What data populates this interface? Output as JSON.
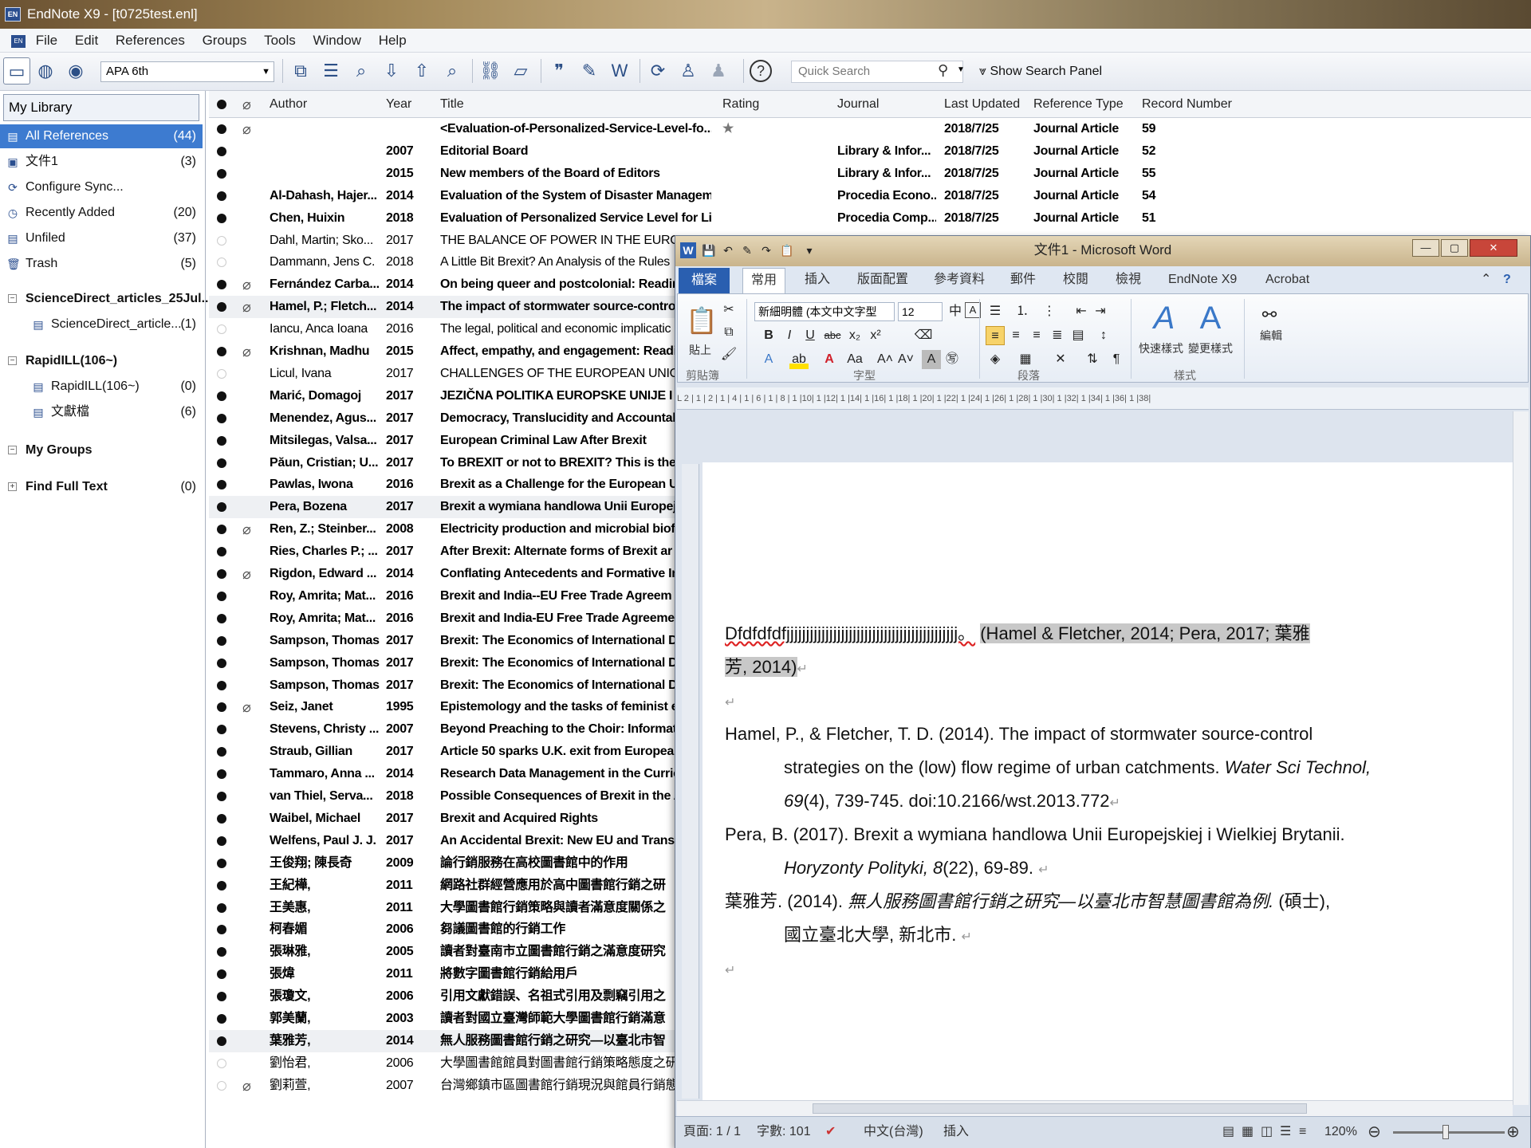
{
  "app": {
    "title": "EndNote X9 - [t0725test.enl]",
    "icon_label": "EN"
  },
  "menu": [
    "File",
    "Edit",
    "References",
    "Groups",
    "Tools",
    "Window",
    "Help"
  ],
  "toolbar": {
    "style": "APA 6th",
    "search_placeholder": "Quick Search",
    "show_search": "Show Search Panel"
  },
  "sidebar": {
    "my_library": "My Library",
    "items": [
      {
        "label": "All References",
        "count": "(44)",
        "icon": "references-icon"
      },
      {
        "label": "文件1",
        "count": "(3)",
        "icon": "word-doc-icon"
      },
      {
        "label": "Configure Sync...",
        "count": "",
        "icon": "sync-icon"
      },
      {
        "label": "Recently Added",
        "count": "(20)",
        "icon": "clock-icon"
      },
      {
        "label": "Unfiled",
        "count": "(37)",
        "icon": "references-icon"
      },
      {
        "label": "Trash",
        "count": "(5)",
        "icon": "trash-icon"
      }
    ],
    "groups": [
      {
        "label": "ScienceDirect_articles_25Jul...",
        "children": [
          {
            "label": "ScienceDirect_article...",
            "count": "(1)"
          }
        ]
      },
      {
        "label": "RapidILL(106~)",
        "children": [
          {
            "label": "RapidILL(106~)",
            "count": "(0)"
          },
          {
            "label": "文獻檔",
            "count": "(6)"
          }
        ]
      },
      {
        "label": "My Groups",
        "children": []
      },
      {
        "label": "Find Full Text",
        "count": "(0)",
        "children": []
      }
    ]
  },
  "columns": [
    "Author",
    "Year",
    "Title",
    "Rating",
    "Journal",
    "Last Updated",
    "Reference Type",
    "Record Number"
  ],
  "rows": [
    {
      "author": "",
      "year": "",
      "title": "<Evaluation-of-Personalized-Service-Level-fo...",
      "rating": "★",
      "journal": "",
      "updated": "2018/7/25",
      "type": "Journal Article",
      "record": "59",
      "clip": true,
      "bold": true,
      "read": true
    },
    {
      "author": "",
      "year": "2007",
      "title": "Editorial Board",
      "rating": "",
      "journal": "Library & Infor...",
      "updated": "2018/7/25",
      "type": "Journal Article",
      "record": "52",
      "clip": false,
      "bold": true,
      "read": true
    },
    {
      "author": "",
      "year": "2015",
      "title": "New members of the Board of Editors",
      "rating": "",
      "journal": "Library & Infor...",
      "updated": "2018/7/25",
      "type": "Journal Article",
      "record": "55",
      "clip": false,
      "bold": true,
      "read": true
    },
    {
      "author": "Al-Dahash, Hajer...",
      "year": "2014",
      "title": "Evaluation of the System of Disaster Managem...",
      "rating": "",
      "journal": "Procedia Econo...",
      "updated": "2018/7/25",
      "type": "Journal Article",
      "record": "54",
      "clip": false,
      "bold": true,
      "read": true
    },
    {
      "author": "Chen, Huixin",
      "year": "2018",
      "title": "Evaluation of Personalized Service Level for Li...",
      "rating": "",
      "journal": "Procedia Comp...",
      "updated": "2018/7/25",
      "type": "Journal Article",
      "record": "51",
      "clip": false,
      "bold": true,
      "read": true
    },
    {
      "author": "Dahl, Martin; Sko...",
      "year": "2017",
      "title": "THE BALANCE OF POWER IN THE EUROPEA",
      "rating": "",
      "journal": "",
      "updated": "",
      "type": "",
      "record": "",
      "clip": false,
      "bold": false,
      "read": false
    },
    {
      "author": "Dammann, Jens C.",
      "year": "2018",
      "title": "A Little Bit Brexit? An Analysis of the Rules",
      "rating": "",
      "journal": "",
      "updated": "",
      "type": "",
      "record": "",
      "clip": false,
      "bold": false,
      "read": false
    },
    {
      "author": "Fernández Carba...",
      "year": "2014",
      "title": "On being queer and postcolonial: Reading",
      "rating": "",
      "journal": "",
      "updated": "",
      "type": "",
      "record": "",
      "clip": true,
      "bold": true,
      "read": true
    },
    {
      "author": "Hamel, P.; Fletch...",
      "year": "2014",
      "title": "The impact of stormwater source-contro",
      "rating": "",
      "journal": "",
      "updated": "",
      "type": "",
      "record": "",
      "clip": true,
      "bold": true,
      "read": true,
      "alt": true
    },
    {
      "author": "Iancu, Anca Ioana",
      "year": "2016",
      "title": "The legal, political and economic implicatic",
      "rating": "",
      "journal": "",
      "updated": "",
      "type": "",
      "record": "",
      "clip": false,
      "bold": false,
      "read": false
    },
    {
      "author": "Krishnan, Madhu",
      "year": "2015",
      "title": "Affect, empathy, and engagement: Readi",
      "rating": "",
      "journal": "",
      "updated": "",
      "type": "",
      "record": "",
      "clip": true,
      "bold": true,
      "read": true
    },
    {
      "author": "Licul, Ivana",
      "year": "2017",
      "title": "CHALLENGES OF THE EUROPEAN UNION A",
      "rating": "",
      "journal": "",
      "updated": "",
      "type": "",
      "record": "",
      "clip": false,
      "bold": false,
      "read": false
    },
    {
      "author": "Marić, Domagoj",
      "year": "2017",
      "title": "JEZIČNA POLITIKA EUROPSKE UNIJE I BR",
      "rating": "",
      "journal": "",
      "updated": "",
      "type": "",
      "record": "",
      "clip": false,
      "bold": true,
      "read": true
    },
    {
      "author": "Menendez, Agus...",
      "year": "2017",
      "title": "Democracy, Translucidity and Accountabi",
      "rating": "",
      "journal": "",
      "updated": "",
      "type": "",
      "record": "",
      "clip": false,
      "bold": true,
      "read": true
    },
    {
      "author": "Mitsilegas, Valsa...",
      "year": "2017",
      "title": "European Criminal Law After Brexit",
      "rating": "",
      "journal": "",
      "updated": "",
      "type": "",
      "record": "",
      "clip": false,
      "bold": true,
      "read": true
    },
    {
      "author": "Păun, Cristian; U...",
      "year": "2017",
      "title": "To BREXIT or not to BREXIT? This is the (e",
      "rating": "",
      "journal": "",
      "updated": "",
      "type": "",
      "record": "",
      "clip": false,
      "bold": true,
      "read": true
    },
    {
      "author": "Pawlas, Iwona",
      "year": "2016",
      "title": "Brexit as a Challenge for the European Ur",
      "rating": "",
      "journal": "",
      "updated": "",
      "type": "",
      "record": "",
      "clip": false,
      "bold": true,
      "read": true
    },
    {
      "author": "Pera, Bozena",
      "year": "2017",
      "title": "Brexit a wymiana handlowa Unii Europejs",
      "rating": "",
      "journal": "",
      "updated": "",
      "type": "",
      "record": "",
      "clip": false,
      "bold": true,
      "read": true,
      "alt": true
    },
    {
      "author": "Ren, Z.; Steinber...",
      "year": "2008",
      "title": "Electricity production and microbial biofil",
      "rating": "",
      "journal": "",
      "updated": "",
      "type": "",
      "record": "",
      "clip": true,
      "bold": true,
      "read": true
    },
    {
      "author": "Ries, Charles P.; ...",
      "year": "2017",
      "title": "After Brexit: Alternate forms of Brexit ar",
      "rating": "",
      "journal": "",
      "updated": "",
      "type": "",
      "record": "",
      "clip": false,
      "bold": true,
      "read": true
    },
    {
      "author": "Rigdon, Edward ...",
      "year": "2014",
      "title": "Conflating Antecedents and Formative In",
      "rating": "",
      "journal": "",
      "updated": "",
      "type": "",
      "record": "",
      "clip": true,
      "bold": true,
      "read": true
    },
    {
      "author": "Roy, Amrita; Mat...",
      "year": "2016",
      "title": "Brexit and India--EU Free Trade Agreem",
      "rating": "",
      "journal": "",
      "updated": "",
      "type": "",
      "record": "",
      "clip": false,
      "bold": true,
      "read": true
    },
    {
      "author": "Roy, Amrita; Mat...",
      "year": "2016",
      "title": "Brexit and India-EU Free Trade Agreeme",
      "rating": "",
      "journal": "",
      "updated": "",
      "type": "",
      "record": "",
      "clip": false,
      "bold": true,
      "read": true
    },
    {
      "author": "Sampson, Thomas",
      "year": "2017",
      "title": "Brexit: The Economics of International D",
      "rating": "",
      "journal": "",
      "updated": "",
      "type": "",
      "record": "",
      "clip": false,
      "bold": true,
      "read": true
    },
    {
      "author": "Sampson, Thomas",
      "year": "2017",
      "title": "Brexit: The Economics of International D",
      "rating": "",
      "journal": "",
      "updated": "",
      "type": "",
      "record": "",
      "clip": false,
      "bold": true,
      "read": true
    },
    {
      "author": "Sampson, Thomas",
      "year": "2017",
      "title": "Brexit: The Economics of International D",
      "rating": "",
      "journal": "",
      "updated": "",
      "type": "",
      "record": "",
      "clip": false,
      "bold": true,
      "read": true
    },
    {
      "author": "Seiz, Janet",
      "year": "1995",
      "title": "Epistemology and the tasks of feminist ec",
      "rating": "",
      "journal": "",
      "updated": "",
      "type": "",
      "record": "",
      "clip": true,
      "bold": true,
      "read": true
    },
    {
      "author": "Stevens, Christy ...",
      "year": "2007",
      "title": "Beyond Preaching to the Choir: Informati",
      "rating": "",
      "journal": "",
      "updated": "",
      "type": "",
      "record": "",
      "clip": false,
      "bold": true,
      "read": true
    },
    {
      "author": "Straub, Gillian",
      "year": "2017",
      "title": "Article 50 sparks U.K. exit from European",
      "rating": "",
      "journal": "",
      "updated": "",
      "type": "",
      "record": "",
      "clip": false,
      "bold": true,
      "read": true
    },
    {
      "author": "Tammaro, Anna ...",
      "year": "2014",
      "title": "Research Data Management in the Curric",
      "rating": "",
      "journal": "",
      "updated": "",
      "type": "",
      "record": "",
      "clip": false,
      "bold": true,
      "read": true
    },
    {
      "author": "van Thiel, Serva...",
      "year": "2018",
      "title": "Possible Consequences of Brexit in the A",
      "rating": "",
      "journal": "",
      "updated": "",
      "type": "",
      "record": "",
      "clip": false,
      "bold": true,
      "read": true
    },
    {
      "author": "Waibel, Michael",
      "year": "2017",
      "title": "Brexit and Acquired Rights",
      "rating": "",
      "journal": "",
      "updated": "",
      "type": "",
      "record": "",
      "clip": false,
      "bold": true,
      "read": true
    },
    {
      "author": "Welfens, Paul J. J.",
      "year": "2017",
      "title": "An Accidental Brexit: New EU and Transa",
      "rating": "",
      "journal": "",
      "updated": "",
      "type": "",
      "record": "",
      "clip": false,
      "bold": true,
      "read": true
    },
    {
      "author": "王俊翔; 陳長奇",
      "year": "2009",
      "title": "論行銷服務在高校圖書館中的作用",
      "rating": "",
      "journal": "",
      "updated": "",
      "type": "",
      "record": "",
      "clip": false,
      "bold": true,
      "read": true
    },
    {
      "author": "王紀樺,",
      "year": "2011",
      "title": "網路社群經營應用於高中圖書館行銷之研",
      "rating": "",
      "journal": "",
      "updated": "",
      "type": "",
      "record": "",
      "clip": false,
      "bold": true,
      "read": true
    },
    {
      "author": "王美惠,",
      "year": "2011",
      "title": "大學圖書館行銷策略與讀者滿意度關係之",
      "rating": "",
      "journal": "",
      "updated": "",
      "type": "",
      "record": "",
      "clip": false,
      "bold": true,
      "read": true
    },
    {
      "author": "柯春媚",
      "year": "2006",
      "title": "芻議圖書館的行銷工作",
      "rating": "",
      "journal": "",
      "updated": "",
      "type": "",
      "record": "",
      "clip": false,
      "bold": true,
      "read": true
    },
    {
      "author": "張琳雅,",
      "year": "2005",
      "title": "讀者對臺南市立圖書館行銷之滿意度研究",
      "rating": "",
      "journal": "",
      "updated": "",
      "type": "",
      "record": "",
      "clip": false,
      "bold": true,
      "read": true
    },
    {
      "author": "張煒",
      "year": "2011",
      "title": "將數字圖書館行銷給用戶",
      "rating": "",
      "journal": "",
      "updated": "",
      "type": "",
      "record": "",
      "clip": false,
      "bold": true,
      "read": true
    },
    {
      "author": "張瓊文,",
      "year": "2006",
      "title": "引用文獻錯誤、名祖式引用及剽竊引用之",
      "rating": "",
      "journal": "",
      "updated": "",
      "type": "",
      "record": "",
      "clip": false,
      "bold": true,
      "read": true
    },
    {
      "author": "郭美蘭,",
      "year": "2003",
      "title": "讀者對國立臺灣師範大學圖書館行銷滿意",
      "rating": "",
      "journal": "",
      "updated": "",
      "type": "",
      "record": "",
      "clip": false,
      "bold": true,
      "read": true
    },
    {
      "author": "葉雅芳,",
      "year": "2014",
      "title": "無人服務圖書館行銷之研究—以臺北市智",
      "rating": "",
      "journal": "",
      "updated": "",
      "type": "",
      "record": "",
      "clip": false,
      "bold": true,
      "read": true,
      "alt": true
    },
    {
      "author": "劉怡君,",
      "year": "2006",
      "title": "大學圖書館館員對圖書館行銷策略態度之研",
      "rating": "",
      "journal": "",
      "updated": "",
      "type": "",
      "record": "",
      "clip": false,
      "bold": false,
      "read": false
    },
    {
      "author": "劉莉萱,",
      "year": "2007",
      "title": "台灣鄉鎮市區圖書館行銷現況與館員行銷態",
      "rating": "",
      "journal": "",
      "updated": "",
      "type": "",
      "record": "",
      "clip": true,
      "bold": false,
      "read": false
    }
  ],
  "word": {
    "title": "文件1 - Microsoft Word",
    "tabs": [
      "檔案",
      "常用",
      "插入",
      "版面配置",
      "參考資料",
      "郵件",
      "校閱",
      "檢視",
      "EndNote X9",
      "Acrobat"
    ],
    "font_name": "新細明體 (本文中文字型",
    "font_size": "12",
    "groups": [
      "剪貼簿",
      "字型",
      "段落",
      "樣式"
    ],
    "paste": "貼上",
    "quick_styles": "快速樣式",
    "change_styles": "變更樣式",
    "edit": "編輯",
    "ruler_text": "L   2 | 1 | 2 | 1 | 4 | 1 | 6 | 1 | 8 | 1 |10| 1 |12| 1 |14| 1 |16| 1 |18| 1 |20| 1 |22| 1 |24| 1 |26| 1 |28| 1 |30| 1 |32| 1 |34| 1 |36| 1 |38|",
    "doc": {
      "line1_text": "Dfdfdfdfjjjjjjjjjjjjjjjjjjjjjjjjjjjjjjjjjjjjjjjjjjjj。",
      "line1_cite": "(Hamel & Fletcher, 2014; Pera, 2017; 葉雅",
      "line2_cite": "芳, 2014)",
      "ref1_a": "Hamel, P., & Fletcher, T. D. (2014). The impact of stormwater source-control",
      "ref1_b": "strategies on the (low) flow regime of urban catchments.",
      "ref1_b_journal": "Water Sci Technol,",
      "ref1_c_vol": "69",
      "ref1_c": "(4), 739-745. doi:10.2166/wst.2013.772",
      "ref2_a": "Pera, B. (2017). Brexit a wymiana handlowa Unii Europejskiej i Wielkiej Brytanii.",
      "ref2_b_journal": "Horyzonty Polityki, 8",
      "ref2_b": "(22), 69-89.",
      "ref3_a": "葉雅芳. (2014).",
      "ref3_a_title": "無人服務圖書館行銷之研究—以臺北市智慧圖書館為例.",
      "ref3_a_end": "(碩士),",
      "ref3_b": "國立臺北大學, 新北市."
    },
    "status": {
      "page": "頁面: 1 / 1",
      "words": "字數: 101",
      "lang": "中文(台灣)",
      "mode": "插入",
      "zoom": "120%"
    }
  }
}
